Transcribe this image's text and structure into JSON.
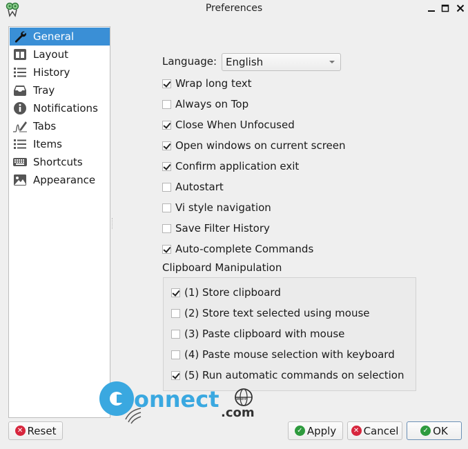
{
  "window": {
    "title": "Preferences",
    "app_icon": "copyq-owl-icon",
    "controls": [
      "minimize-icon",
      "maximize-icon",
      "close-icon"
    ]
  },
  "sidebar": {
    "items": [
      {
        "label": "General",
        "icon": "wrench-icon",
        "active": true
      },
      {
        "label": "Layout",
        "icon": "layout-icon",
        "active": false
      },
      {
        "label": "History",
        "icon": "list-icon",
        "active": false
      },
      {
        "label": "Tray",
        "icon": "tray-icon",
        "active": false
      },
      {
        "label": "Notifications",
        "icon": "info-icon",
        "active": false
      },
      {
        "label": "Tabs",
        "icon": "signature-pen-icon",
        "active": false
      },
      {
        "label": "Items",
        "icon": "list-icon",
        "active": false
      },
      {
        "label": "Shortcuts",
        "icon": "keyboard-icon",
        "active": false
      },
      {
        "label": "Appearance",
        "icon": "image-icon",
        "active": false
      }
    ]
  },
  "general": {
    "language_label": "Language:",
    "language_value": "English",
    "options": [
      {
        "label": "Wrap long text",
        "checked": true
      },
      {
        "label": "Always on Top",
        "checked": false
      },
      {
        "label": "Close When Unfocused",
        "checked": true
      },
      {
        "label": "Open windows on current screen",
        "checked": true
      },
      {
        "label": "Confirm application exit",
        "checked": true
      },
      {
        "label": "Autostart",
        "checked": false
      },
      {
        "label": "Vi style navigation",
        "checked": false
      },
      {
        "label": "Save Filter History",
        "checked": false
      },
      {
        "label": "Auto-complete Commands",
        "checked": true
      }
    ],
    "clipboard_group": {
      "title": "Clipboard Manipulation",
      "options": [
        {
          "label": "(1) Store clipboard",
          "checked": true
        },
        {
          "label": "(2) Store text selected using mouse",
          "checked": false
        },
        {
          "label": "(3) Paste clipboard with mouse",
          "checked": false
        },
        {
          "label": "(4) Paste mouse selection with keyboard",
          "checked": false
        },
        {
          "label": "(5) Run automatic commands on selection",
          "checked": true
        }
      ]
    }
  },
  "buttons": {
    "reset": "Reset",
    "apply": "Apply",
    "cancel": "Cancel",
    "ok": "OK"
  },
  "watermark": {
    "text": "onnect",
    "suffix": ".com",
    "globe_text": "www",
    "color": "#3aa8e0"
  },
  "colors": {
    "selection": "#3a8fd6",
    "ok_green": "#2e9b3e",
    "cancel_red": "#d7263d"
  }
}
